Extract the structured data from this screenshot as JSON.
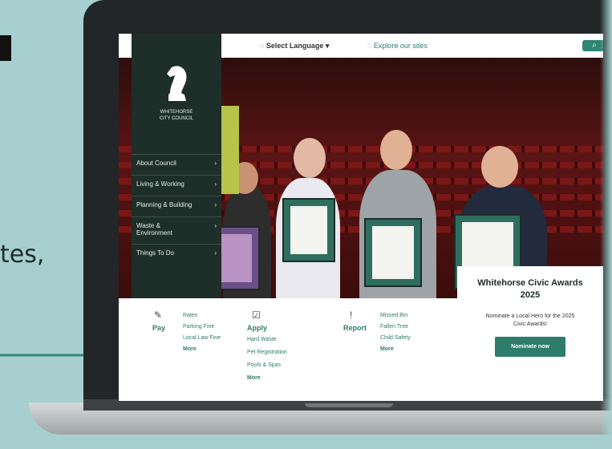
{
  "outside": {
    "partial_text": "tes,"
  },
  "topbar": {
    "language": "Select Language",
    "explore": "Explore our sites"
  },
  "sidebar": {
    "logo_line1": "WHITEHORSE",
    "logo_line2": "CITY COUNCIL",
    "items": [
      {
        "label": "About Council"
      },
      {
        "label": "Living & Working"
      },
      {
        "label": "Planning & Building"
      },
      {
        "label": "Waste & Environment"
      },
      {
        "label": "Things To Do"
      }
    ]
  },
  "cta": {
    "title_line1": "Whitehorse Civic Awards",
    "title_line2": "2025",
    "subtitle_line1": "Nominate a Local Hero for the 2025",
    "subtitle_line2": "Civic Awards!",
    "button": "Nominate now"
  },
  "services": {
    "pay": {
      "title": "Pay",
      "links": [
        "Rates",
        "Parking Fine",
        "Local Law Fine"
      ],
      "more": "More"
    },
    "apply": {
      "title": "Apply",
      "links": [
        "Hard Waste",
        "Pet Registration",
        "Pools & Spas"
      ],
      "more": "More"
    },
    "report": {
      "title": "Report",
      "links": [
        "Missed Bin",
        "Fallen Tree",
        "Child Safety"
      ],
      "more": "More"
    }
  },
  "colors": {
    "background": "#a8cfcf",
    "brand_green": "#2e7c6a",
    "sidebar": "#1e2e29"
  },
  "icons": {
    "search": "search-icon",
    "globe": "globe-icon",
    "horse": "chess-knight-icon"
  }
}
